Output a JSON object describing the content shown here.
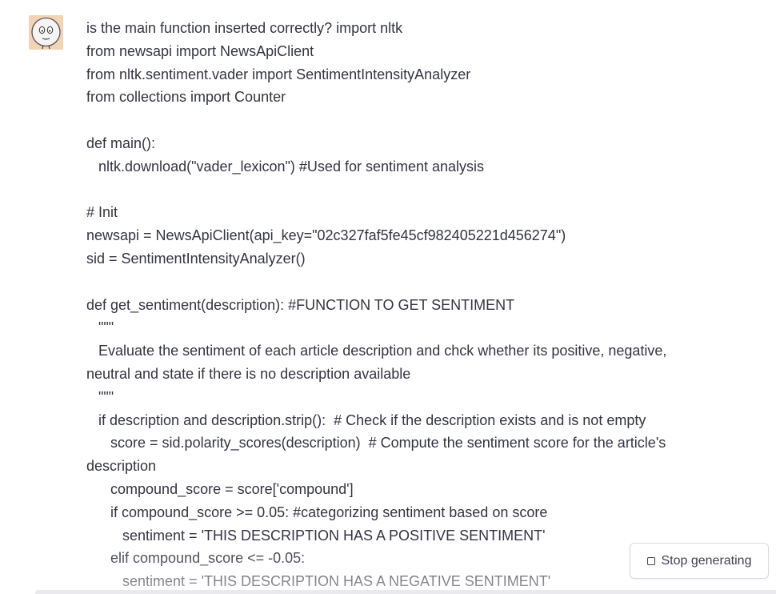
{
  "chat": {
    "user_avatar_icon": "cartoon-face-avatar",
    "message_lines": [
      "is the main function inserted correctly? import nltk",
      "from newsapi import NewsApiClient",
      "from nltk.sentiment.vader import SentimentIntensityAnalyzer",
      "from collections import Counter",
      "",
      "def main():",
      "   nltk.download(\"vader_lexicon\") #Used for sentiment analysis",
      "",
      "# Init",
      "newsapi = NewsApiClient(api_key=\"02c327faf5fe45cf982405221d456274\")",
      "sid = SentimentIntensityAnalyzer()",
      "",
      "def get_sentiment(description): #FUNCTION TO GET SENTIMENT",
      "   \"\"\"",
      "   Evaluate the sentiment of each article description and chck whether its positive, negative,",
      "neutral and state if there is no description available",
      "   \"\"\"",
      "   if description and description.strip():  # Check if the description exists and is not empty",
      "      score = sid.polarity_scores(description)  # Compute the sentiment score for the article's",
      "description",
      "      compound_score = score['compound']",
      "      if compound_score >= 0.05: #categorizing sentiment based on score",
      "         sentiment = 'THIS DESCRIPTION HAS A POSITIVE SENTIMENT'",
      "      elif compound_score <= -0.05:",
      "         sentiment = 'THIS DESCRIPTION HAS A NEGATIVE SENTIMENT'"
    ]
  },
  "controls": {
    "stop_label": "Stop generating",
    "stop_icon": "stop-square-icon"
  },
  "colors": {
    "text": "#343541",
    "avatar_bg": "#f2d3b3",
    "button_border": "#d9d9e3"
  }
}
